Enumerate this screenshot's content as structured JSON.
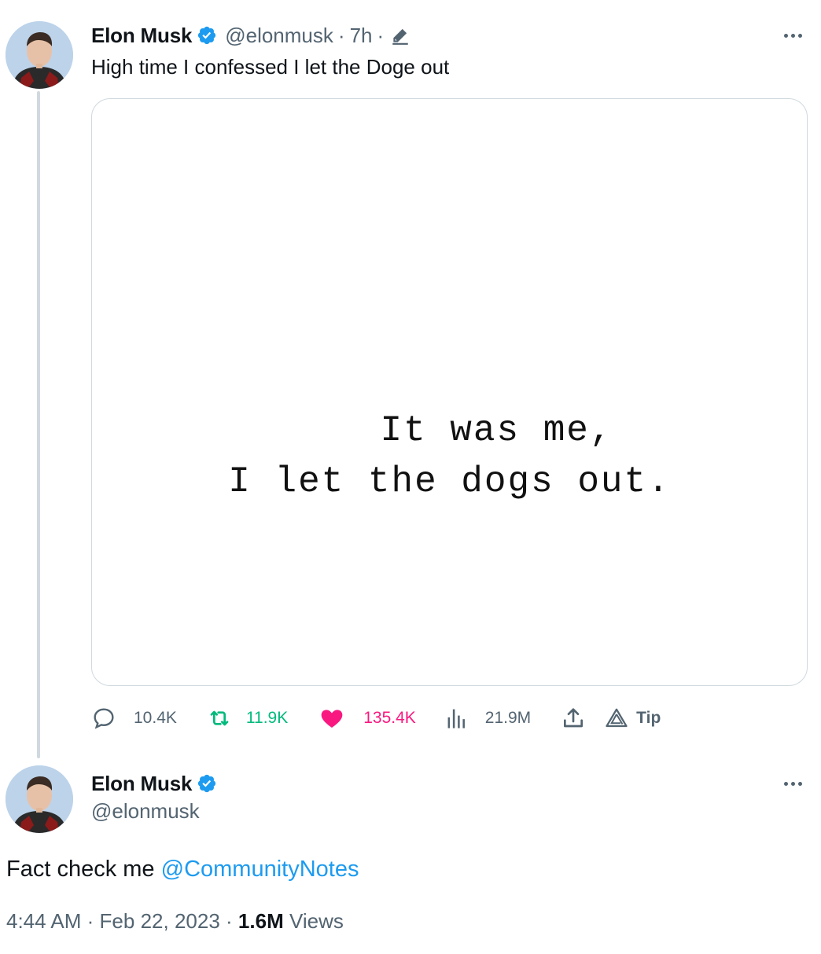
{
  "tweet1": {
    "display_name": "Elon Musk",
    "handle": "@elonmusk",
    "separator1": "·",
    "age": "7h",
    "separator2": "·",
    "text": "High time I confessed I let the Doge out",
    "media": {
      "line1": "It was me,",
      "line2": "I let the dogs out."
    },
    "actions": {
      "replies": "10.4K",
      "reposts": "11.9K",
      "likes": "135.4K",
      "views": "21.9M",
      "tip_label": "Tip"
    }
  },
  "tweet2": {
    "display_name": "Elon Musk",
    "handle": "@elonmusk",
    "text_prefix": "Fact check me ",
    "mention": "@CommunityNotes",
    "time": "4:44 AM",
    "dot1": "·",
    "date": "Feb 22, 2023",
    "dot2": "·",
    "views_count": "1.6M",
    "views_label": "Views"
  },
  "colors": {
    "text": "#0f1419",
    "muted": "#536471",
    "verified": "#1d9bf0",
    "repost": "#00ba7c",
    "like": "#f91880",
    "link": "#1d9bf0",
    "border": "#cfd9de"
  },
  "icons": {
    "verified": "verified-badge-icon",
    "edit": "pencil-icon",
    "reply": "speech-bubble-icon",
    "repost": "repost-icon",
    "like": "heart-icon",
    "views": "bar-chart-icon",
    "share": "share-upload-icon",
    "tip": "tip-triangle-icon",
    "more": "more-dots-icon"
  }
}
